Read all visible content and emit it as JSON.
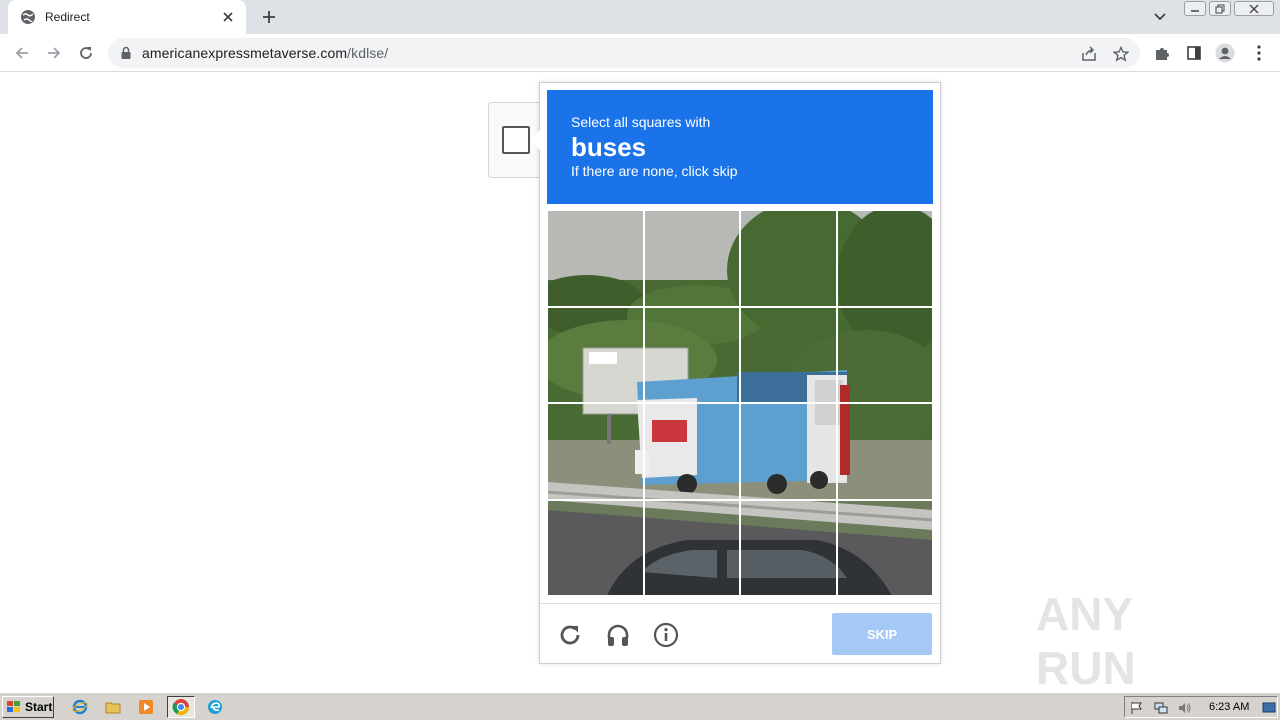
{
  "browser": {
    "tab": {
      "title": "Redirect"
    },
    "url": {
      "domain": "americanexpressmetaverse.com",
      "path": "/kdlse/"
    }
  },
  "captcha": {
    "prompt_line1": "Select all squares with",
    "keyword": "buses",
    "prompt_line3": "If there are none, click skip",
    "grid_rows": 4,
    "grid_cols": 4,
    "skip_label": "SKIP",
    "icons": [
      "reload-icon",
      "audio-icon",
      "info-icon"
    ],
    "colors": {
      "header": "#1a73e8",
      "skip": "#a6c8f5"
    }
  },
  "watermark": {
    "text": "ANY RUN"
  },
  "taskbar": {
    "start_label": "Start",
    "clock": "6:23 AM"
  }
}
